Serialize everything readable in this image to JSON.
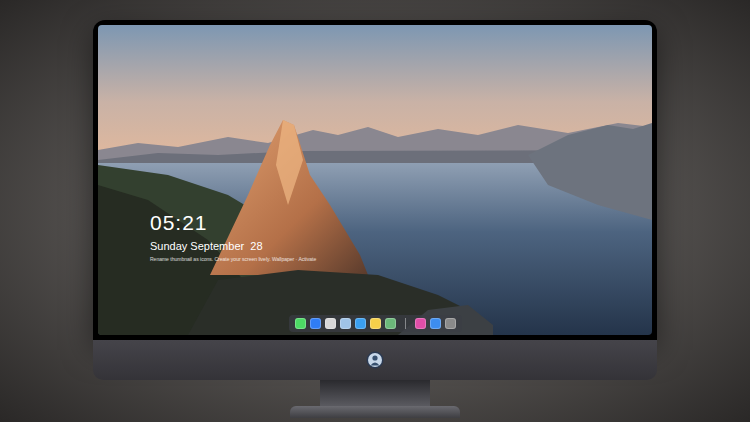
{
  "lock_screen": {
    "time": "05:21",
    "date": "Sunday September  28",
    "note": "Rename thumbnail as icons. Create your screen lively. Wallpaper · Activate"
  },
  "dock": {
    "apps": [
      {
        "color": "#4cd964"
      },
      {
        "color": "#2f7df6"
      },
      {
        "color": "#d8d8d8"
      },
      {
        "color": "#9fc3e6"
      },
      {
        "color": "#3aa0f0"
      },
      {
        "color": "#f5d04a"
      },
      {
        "color": "#6cb87a"
      }
    ],
    "extra": [
      {
        "color": "#e04ea8"
      },
      {
        "color": "#3d8df0"
      },
      {
        "color": "#8a8a8a"
      }
    ]
  }
}
